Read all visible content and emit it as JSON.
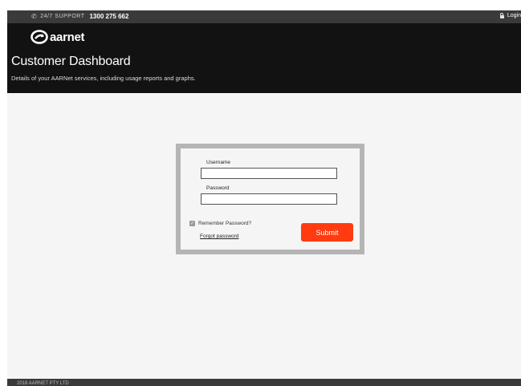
{
  "topbar": {
    "support_label": "24/7 SUPPORT",
    "support_phone": "1300 275 662",
    "login_label": "Login"
  },
  "header": {
    "logo_text": "aarnet",
    "title": "Customer Dashboard",
    "subtitle": "Details of your AARNet services, including usage reports and graphs."
  },
  "login_form": {
    "username_label": "Username",
    "username_value": "",
    "password_label": "Password",
    "password_value": "",
    "remember_label": "Remember Password?",
    "remember_checked": true,
    "forgot_label": "Forgot password",
    "submit_label": "Submit"
  },
  "footer": {
    "copyright": "2018 AARNET PTY LTD"
  },
  "colors": {
    "header_bg": "#121212",
    "topbar_bg": "#3a3a3a",
    "accent": "#ff3b0f",
    "card_border": "#b5b5b5",
    "page_bg": "#f5f5f5"
  },
  "icons": {
    "support": "phone-icon",
    "login": "lock-icon",
    "logo": "aarnet-logo-icon",
    "remember": "check-icon"
  }
}
